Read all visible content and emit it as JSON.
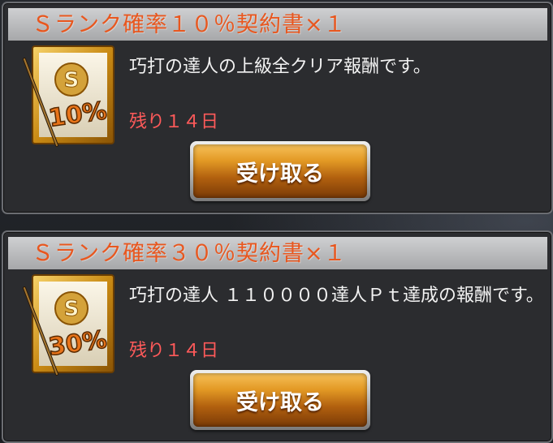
{
  "rewards": [
    {
      "title": "Ｓランク確率１０％契約書×１",
      "icon_name": "s-rank-10-percent-contract-icon",
      "icon_badge": "10%",
      "description": "巧打の達人の上級全クリア報酬です。",
      "remaining": "残り１４日",
      "button_label": "受け取る"
    },
    {
      "title": "Ｓランク確率３０％契約書×１",
      "icon_name": "s-rank-30-percent-contract-icon",
      "icon_badge": "30%",
      "description": "巧打の達人 １１００００達人Ｐｔ達成の報酬です。",
      "remaining": "残り１４日",
      "button_label": "受け取る"
    }
  ],
  "colors": {
    "title": "#e8571f",
    "remaining": "#ff5a5a",
    "button": "#e39a25"
  }
}
